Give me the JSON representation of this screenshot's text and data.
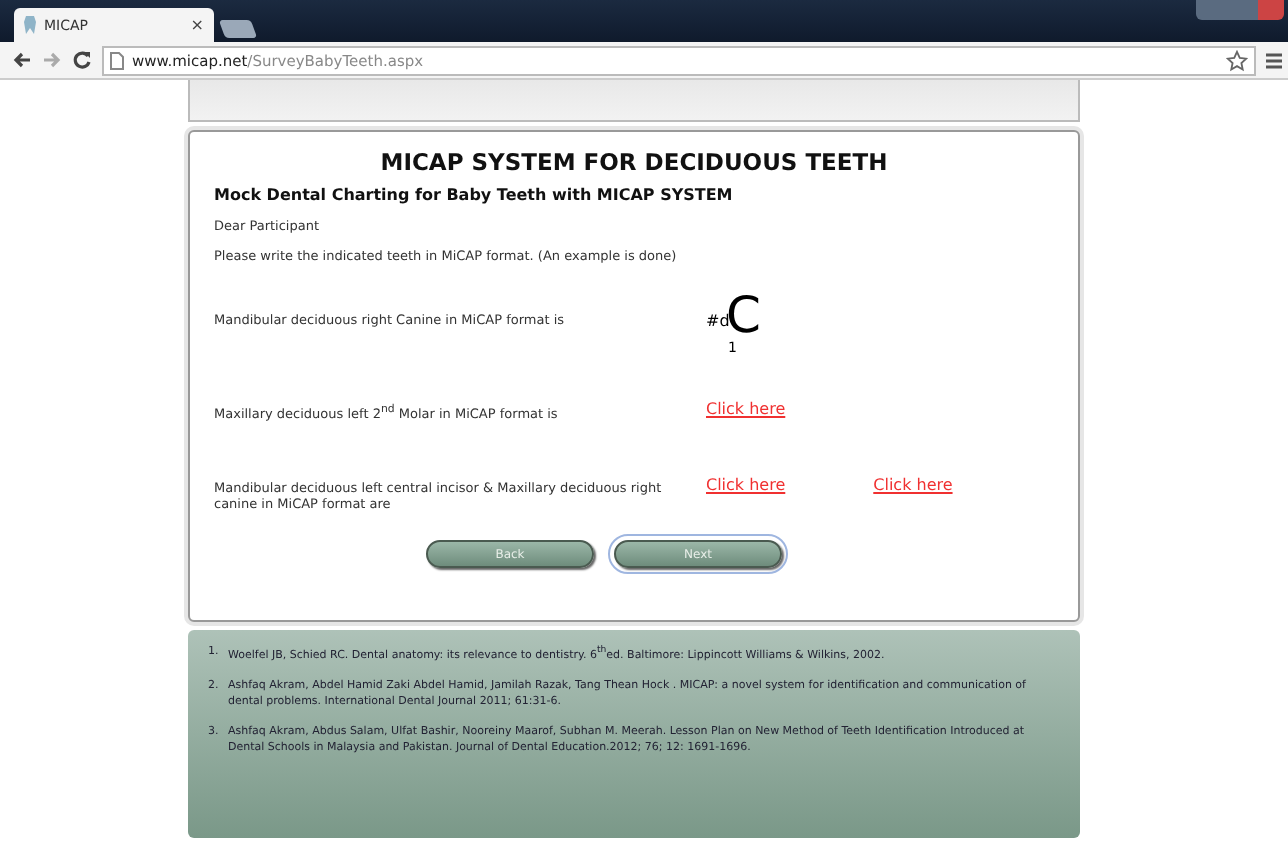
{
  "browser": {
    "tab_title": "MICAP",
    "tab_close": "×",
    "url_host": "www.micap.net",
    "url_path": "/SurveyBabyTeeth.aspx"
  },
  "page": {
    "title": "MICAP SYSTEM FOR DECIDUOUS TEETH",
    "subtitle": "Mock Dental Charting for Baby Teeth with MICAP SYSTEM",
    "greeting": "Dear Participant",
    "instruction": "Please write the indicated teeth in MiCAP format. (An example is done)",
    "questions": [
      {
        "kind": "example",
        "text": "Mandibular deciduous right Canine in MiCAP format is",
        "prefix": "#d",
        "letter": "C",
        "index": "1"
      },
      {
        "kind": "links",
        "text": "Maxillary deciduous left 2$^{nd}$ Molar in MiCAP format is",
        "links": [
          "Click here"
        ]
      },
      {
        "kind": "links",
        "text": "Mandibular deciduous left central incisor & Maxillary deciduous right canine in MiCAP format are",
        "links": [
          "Click here",
          "Click here"
        ]
      }
    ],
    "buttons": [
      {
        "label": "Back",
        "selected": false
      },
      {
        "label": "Next",
        "selected": true
      }
    ]
  },
  "references": [
    {
      "number": "1.",
      "text": "Woelfel JB, Schied RC. Dental anatomy: its relevance to dentistry. 6$^{th}$ed. Baltimore: Lippincott Williams & Wilkins, 2002."
    },
    {
      "number": "2.",
      "text": "Ashfaq Akram, Abdel Hamid Zaki Abdel Hamid, Jamilah Razak, Tang Thean Hock . MICAP: a novel system for identification and communication of dental problems. International Dental Journal 2011; 61:31-6."
    },
    {
      "number": "3.",
      "text": "Ashfaq Akram, Abdus Salam, Ulfat Bashir, Nooreiny Maarof, Subhan M. Meerah. Lesson Plan on New Method of Teeth Identification Introduced at Dental Schools in Malaysia and Pakistan. Journal of Dental Education.2012; 76; 12: 1691-1696."
    }
  ]
}
